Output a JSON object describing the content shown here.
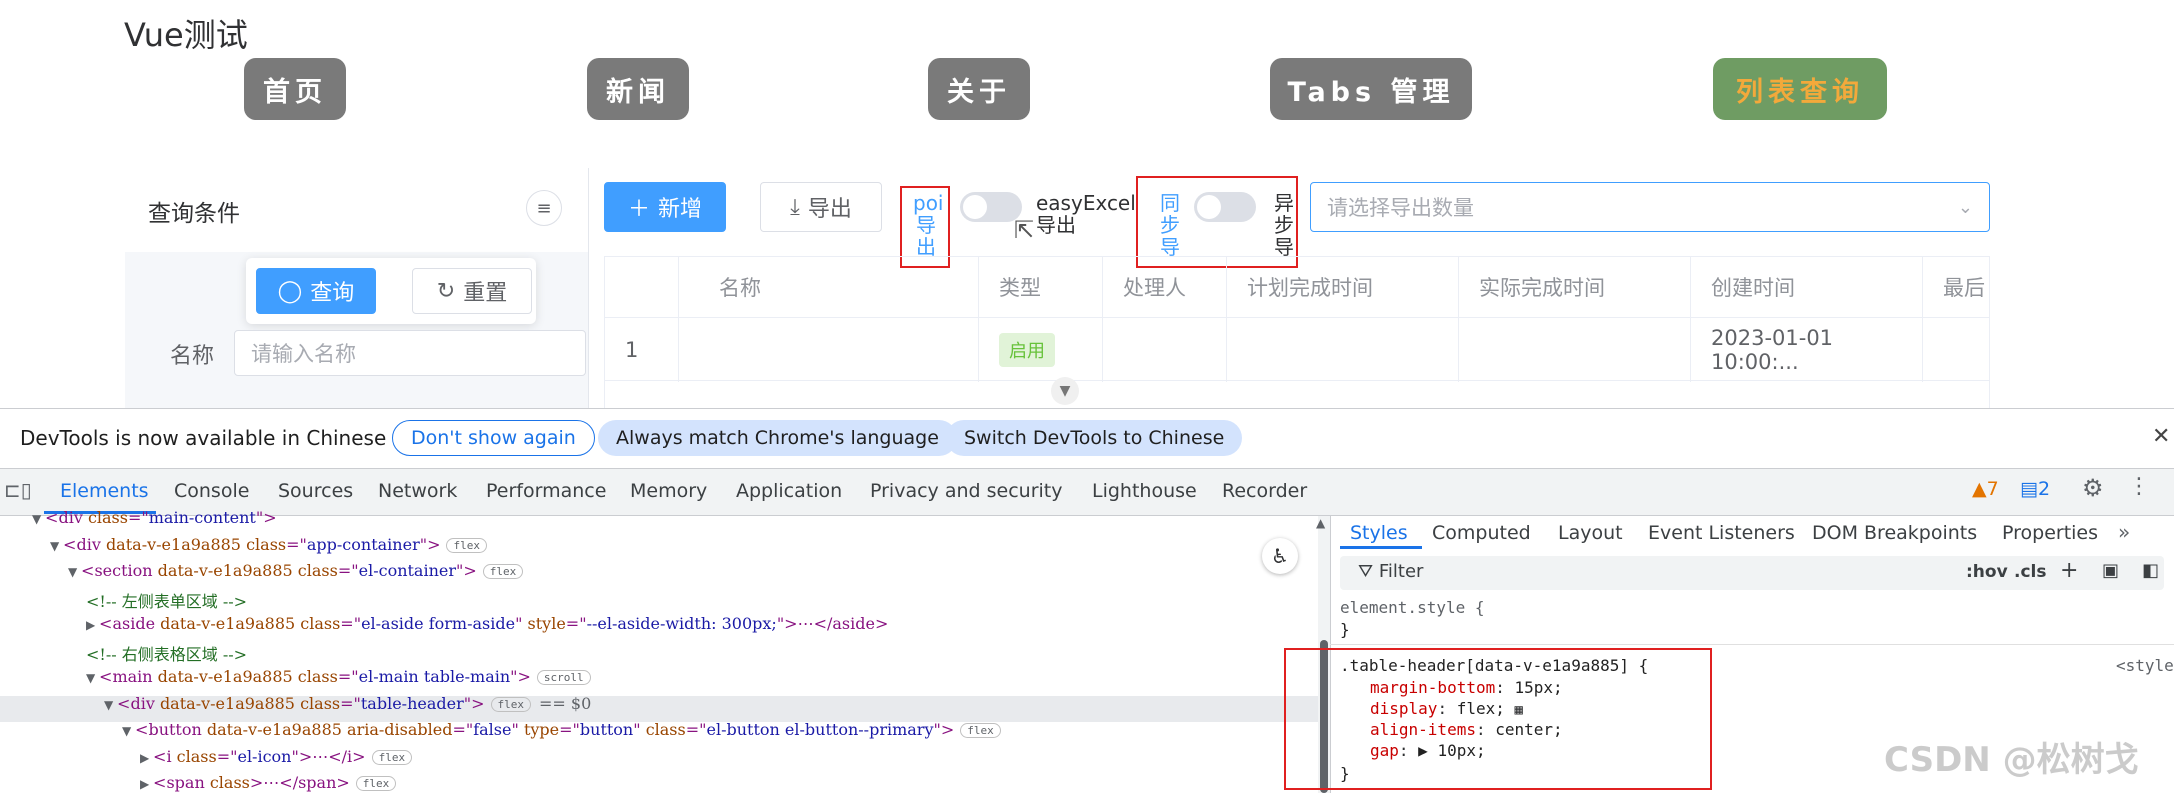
{
  "app": {
    "title": "Vue测试",
    "nav": [
      "首页",
      "新闻",
      "关于",
      "Tabs 管理",
      "列表查询"
    ]
  },
  "sidebar": {
    "title": "查询条件",
    "query_button": "查询",
    "reset_button": "重置",
    "name_label": "名称",
    "name_placeholder": "请输入名称"
  },
  "toolbar": {
    "add_button": "新增",
    "export_button": "导出",
    "poi_label": [
      "poi",
      "导",
      "出"
    ],
    "easyexcel_label": [
      "easyExcel",
      "导出"
    ],
    "sync_label": [
      "同",
      "步",
      "导"
    ],
    "async_label": [
      "异",
      "步",
      "导"
    ],
    "export_count_placeholder": "请选择导出数量"
  },
  "table": {
    "headers": [
      "",
      "名称",
      "类型",
      "处理人",
      "计划完成时间",
      "实际完成时间",
      "创建时间",
      "最后"
    ],
    "rows": [
      {
        "index": "1",
        "name": "",
        "type": "启用",
        "handler": "",
        "plan": "",
        "actual": "",
        "created": "2023-01-01 10:00:..."
      }
    ]
  },
  "devtools": {
    "infobar": {
      "text": "DevTools is now available in Chinese",
      "dont_show": "Don't show again",
      "always_match": "Always match Chrome's language",
      "switch_chinese": "Switch DevTools to Chinese"
    },
    "tabs": [
      "Elements",
      "Console",
      "Sources",
      "Network",
      "Performance",
      "Memory",
      "Application",
      "Privacy and security",
      "Lighthouse",
      "Recorder"
    ],
    "warnings": "7",
    "messages": "2",
    "styles_tabs": [
      "Styles",
      "Computed",
      "Layout",
      "Event Listeners",
      "DOM Breakpoints",
      "Properties"
    ],
    "filter_placeholder": "Filter",
    "hov": ":hov",
    "cls": ".cls",
    "dom_lines": [
      {
        "indent": 0,
        "tri": "▼",
        "segments": [
          [
            "tag",
            "<div "
          ],
          [
            "attr",
            "class"
          ],
          [
            "tag",
            "=\""
          ],
          [
            "val",
            "main-content"
          ],
          [
            "tag",
            "\">"
          ]
        ]
      },
      {
        "indent": 1,
        "tri": "▼",
        "segments": [
          [
            "tag",
            "<div "
          ],
          [
            "attr",
            "data-v-e1a9a885 class"
          ],
          [
            "tag",
            "=\""
          ],
          [
            "val",
            "app-container"
          ],
          [
            "tag",
            "\">"
          ]
        ],
        "badge": "flex"
      },
      {
        "indent": 2,
        "tri": "▼",
        "segments": [
          [
            "tag",
            "<section "
          ],
          [
            "attr",
            "data-v-e1a9a885 class"
          ],
          [
            "tag",
            "=\""
          ],
          [
            "val",
            "el-container"
          ],
          [
            "tag",
            "\">"
          ]
        ],
        "badge": "flex"
      },
      {
        "indent": 3,
        "tri": "",
        "segments": [
          [
            "comment",
            "<!-- 左侧表单区域 -->"
          ]
        ]
      },
      {
        "indent": 3,
        "tri": "▶",
        "segments": [
          [
            "tag",
            "<aside "
          ],
          [
            "attr",
            "data-v-e1a9a885 class"
          ],
          [
            "tag",
            "=\""
          ],
          [
            "val",
            "el-aside form-aside"
          ],
          [
            "tag",
            "\" "
          ],
          [
            "attr",
            "style"
          ],
          [
            "tag",
            "=\""
          ],
          [
            "val",
            "--el-aside-width: 300px;"
          ],
          [
            "tag",
            "\">"
          ],
          [
            "tag",
            "⋯"
          ],
          [
            "tag",
            "</aside>"
          ]
        ]
      },
      {
        "indent": 3,
        "tri": "",
        "segments": [
          [
            "comment",
            "<!-- 右侧表格区域 -->"
          ]
        ]
      },
      {
        "indent": 3,
        "tri": "▼",
        "segments": [
          [
            "tag",
            "<main "
          ],
          [
            "attr",
            "data-v-e1a9a885 class"
          ],
          [
            "tag",
            "=\""
          ],
          [
            "val",
            "el-main table-main"
          ],
          [
            "tag",
            "\">"
          ]
        ],
        "badge": "scroll"
      },
      {
        "indent": 4,
        "tri": "▼",
        "segments": [
          [
            "tag",
            "<div "
          ],
          [
            "attr",
            "data-v-e1a9a885 class"
          ],
          [
            "tag",
            "=\""
          ],
          [
            "val",
            "table-header"
          ],
          [
            "tag",
            "\">"
          ]
        ],
        "badge": "flex",
        "suffix": "== $0"
      },
      {
        "indent": 5,
        "tri": "▼",
        "segments": [
          [
            "tag",
            "<button "
          ],
          [
            "attr",
            "data-v-e1a9a885 aria-disabled"
          ],
          [
            "tag",
            "=\""
          ],
          [
            "val",
            "false"
          ],
          [
            "tag",
            "\" "
          ],
          [
            "attr",
            "type"
          ],
          [
            "tag",
            "=\""
          ],
          [
            "val",
            "button"
          ],
          [
            "tag",
            "\" "
          ],
          [
            "attr",
            "class"
          ],
          [
            "tag",
            "=\""
          ],
          [
            "val",
            "el-button el-button--primary"
          ],
          [
            "tag",
            "\">"
          ]
        ],
        "badge": "flex"
      },
      {
        "indent": 6,
        "tri": "▶",
        "segments": [
          [
            "tag",
            "<i "
          ],
          [
            "attr",
            "class"
          ],
          [
            "tag",
            "=\""
          ],
          [
            "val",
            "el-icon"
          ],
          [
            "tag",
            "\">"
          ],
          [
            "tag",
            "⋯"
          ],
          [
            "tag",
            "</i>"
          ]
        ],
        "badge": "flex"
      },
      {
        "indent": 6,
        "tri": "▶",
        "segments": [
          [
            "tag",
            "<span "
          ],
          [
            "attr",
            "class"
          ],
          [
            "tag",
            ">"
          ],
          [
            "tag",
            "⋯"
          ],
          [
            "tag",
            "</span>"
          ]
        ],
        "badge": "flex"
      }
    ],
    "styles": {
      "element_style": "element.style {",
      "close": "}",
      "selector": ".table-header[data-v-e1a9a885] {",
      "source": "<style>",
      "props": [
        {
          "name": "margin-bottom",
          "value": "15px;"
        },
        {
          "name": "display",
          "value": "flex;"
        },
        {
          "name": "align-items",
          "value": "center;"
        },
        {
          "name": "gap",
          "value": "▶ 10px;"
        }
      ]
    }
  },
  "watermark": "CSDN @松树戈",
  "colors": {
    "primary": "#409eff",
    "devtools_blue": "#1a73e8",
    "highlight_red": "#e02020"
  }
}
